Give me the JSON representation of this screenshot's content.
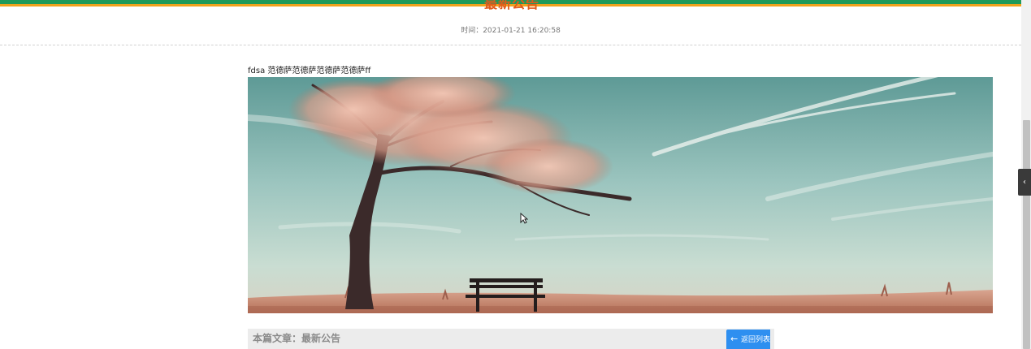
{
  "header": {
    "title": "最新公告",
    "time": "时间：2021-01-21 16:20:58"
  },
  "article": {
    "body_text": "fdsa 范德萨范德萨范德萨范德萨ff",
    "image_alt": "tree-bench-landscape"
  },
  "footer": {
    "current_article_prefix": "本篇文章：",
    "current_article_title": "最新公告",
    "back_button_label": "返回列表"
  },
  "colors": {
    "stripe_green": "#1f9a5a",
    "stripe_orange": "#f0a21c",
    "title_orange": "#e25a1c",
    "button_blue": "#2e8ff0"
  },
  "icons": {
    "back": "arrow-left-icon",
    "side_toggle": "chevron-left-icon",
    "cursor": "mouse-pointer-icon"
  }
}
